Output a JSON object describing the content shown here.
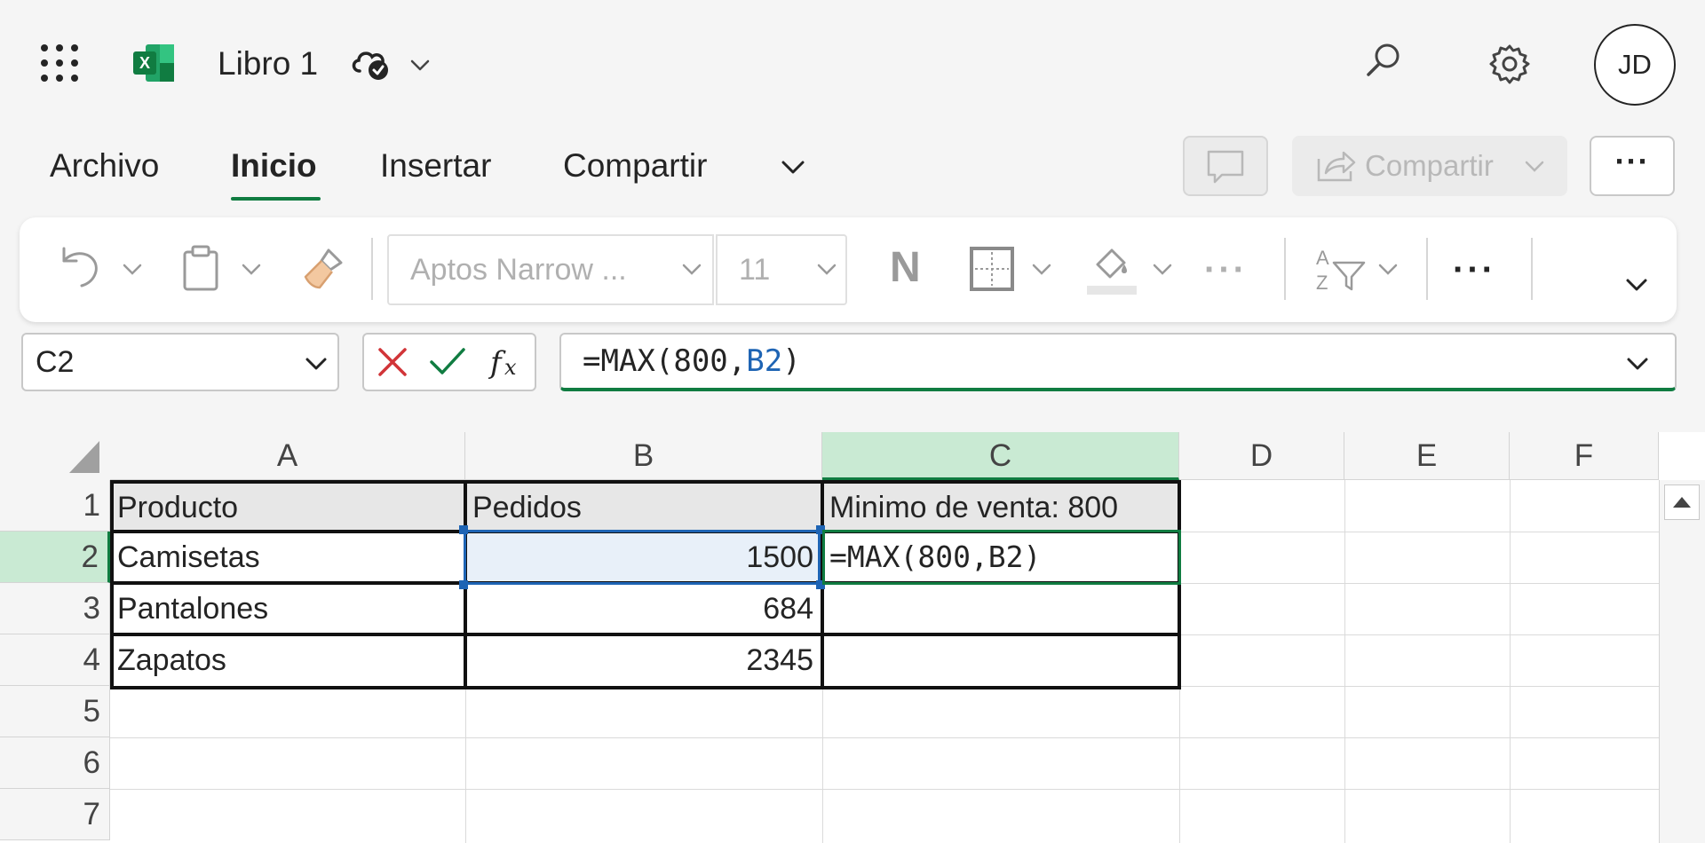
{
  "titlebar": {
    "doc_title": "Libro 1",
    "app_icon_label": "X",
    "avatar_initials": "JD"
  },
  "menu": {
    "tabs": [
      {
        "label": "Archivo"
      },
      {
        "label": "Inicio"
      },
      {
        "label": "Insertar"
      },
      {
        "label": "Compartir"
      }
    ],
    "active_tab": "Inicio",
    "share_label": "Compartir",
    "more_label": "···"
  },
  "ribbon": {
    "font_name": "Aptos Narrow ...",
    "font_size": "11",
    "bold_label": "N",
    "more_label": "···"
  },
  "formula_bar": {
    "name_box": "C2",
    "formula_prefix": "=MAX(800,",
    "formula_ref": "B2",
    "formula_suffix": ")"
  },
  "grid": {
    "columns": [
      "A",
      "B",
      "C",
      "D",
      "E",
      "F"
    ],
    "rows": [
      "1",
      "2",
      "3",
      "4",
      "5",
      "6",
      "7"
    ],
    "selected_column": "C",
    "selected_row": "2",
    "cells": {
      "A1": "Producto",
      "B1": "Pedidos",
      "C1": "Minimo de venta: 800",
      "A2": "Camisetas",
      "B2": "1500",
      "C2": "=MAX(800,B2)",
      "A3": "Pantalones",
      "B3": "684",
      "A4": "Zapatos",
      "B4": "2345"
    }
  },
  "colors": {
    "accent_green": "#107c41",
    "selected_header_bg": "#c9ead3",
    "reference_blue": "#1e64b4"
  }
}
